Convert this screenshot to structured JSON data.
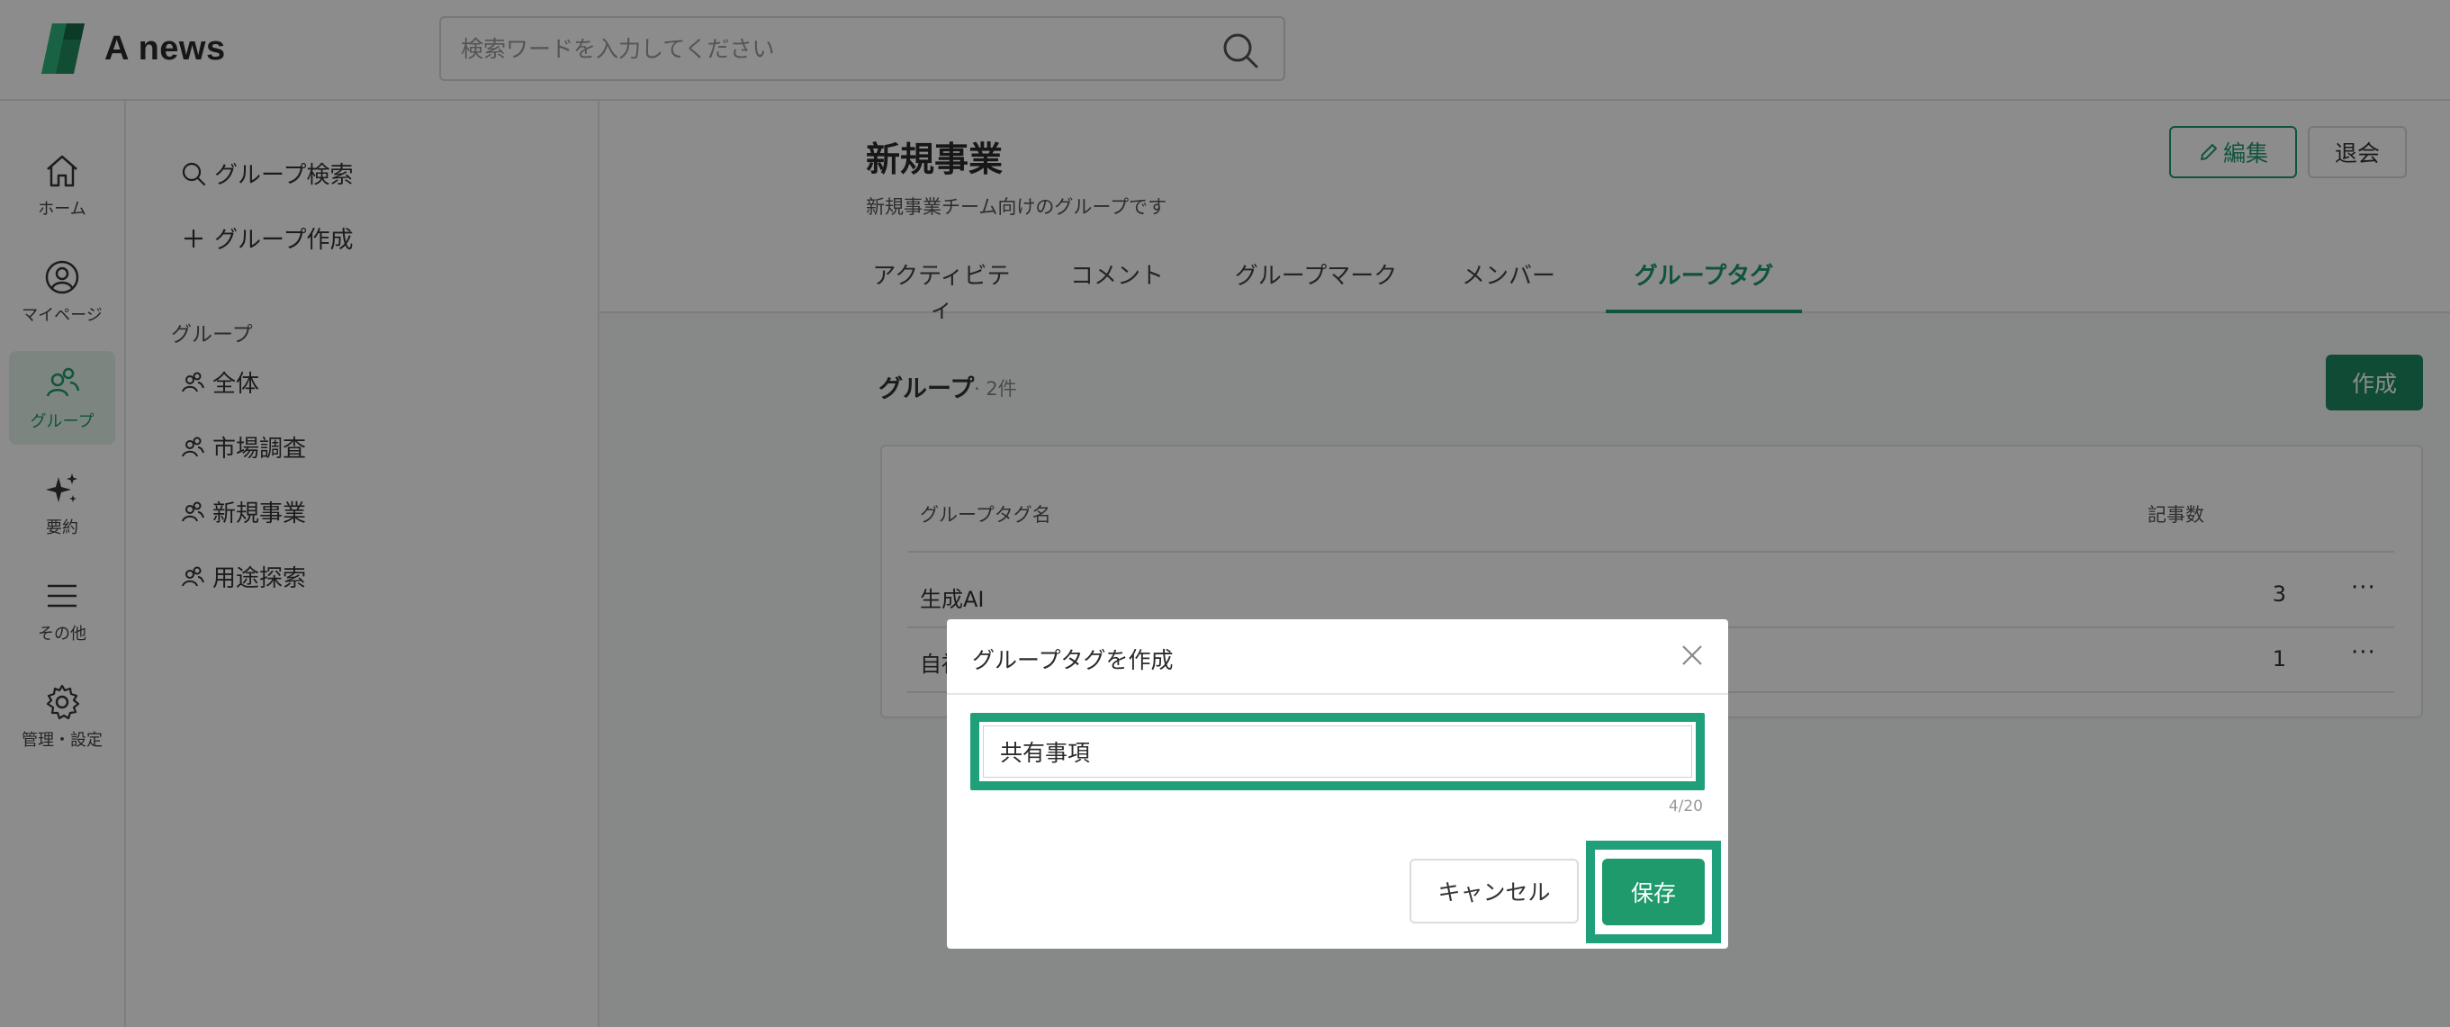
{
  "app": {
    "name": "A news"
  },
  "colors": {
    "accent": "#1e9a6c",
    "highlight": "#20a07a",
    "overlay": "rgba(0,0,0,0.45)"
  },
  "header": {
    "search_placeholder": "検索ワードを入力してください",
    "search_value": ""
  },
  "rail": {
    "items": [
      {
        "label": "ホーム",
        "icon": "home-icon"
      },
      {
        "label": "マイページ",
        "icon": "user-circle-icon"
      },
      {
        "label": "グループ",
        "icon": "group-icon",
        "active": true
      },
      {
        "label": "要約",
        "icon": "sparkle-icon"
      },
      {
        "label": "その他",
        "icon": "menu-icon"
      },
      {
        "label": "管理・設定",
        "icon": "gear-icon"
      }
    ]
  },
  "groupbar": {
    "search_label": "グループ検索",
    "create_label": "グループ作成",
    "heading": "グループ",
    "groups": [
      "全体",
      "市場調査",
      "新規事業",
      "用途探索"
    ]
  },
  "main": {
    "title": "新規事業",
    "description": "新規事業チーム向けのグループです",
    "edit_label": "編集",
    "leave_label": "退会",
    "tabs": [
      "アクティビティ",
      "コメント",
      "グループマーク",
      "メンバー",
      "グループタグ"
    ],
    "active_tab": "グループタグ",
    "section_title": "グループ",
    "section_count": "· 2件",
    "create_label": "作成",
    "table": {
      "headers": [
        "グループタグ名",
        "記事数"
      ],
      "rows": [
        {
          "name": "生成AI",
          "count": "3",
          "more": "···"
        },
        {
          "name": "自社",
          "count": "1",
          "more": "···"
        }
      ]
    }
  },
  "modal": {
    "title": "グループタグを作成",
    "input_value": "共有事項",
    "char_count": "4/20",
    "cancel_label": "キャンセル",
    "save_label": "保存"
  }
}
